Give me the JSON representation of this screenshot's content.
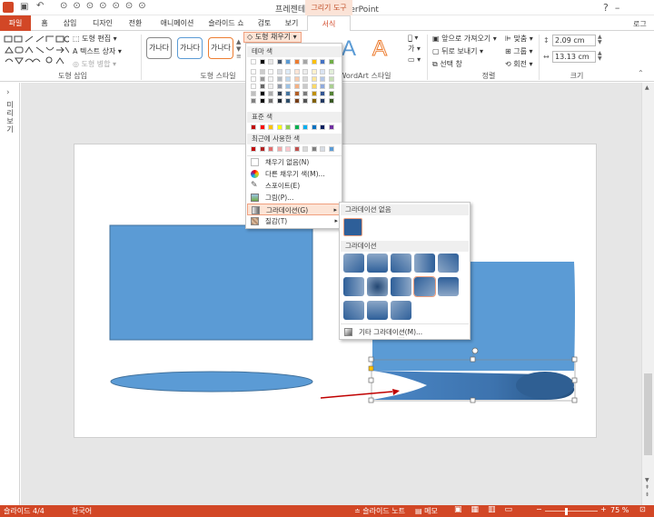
{
  "window": {
    "title": "프레젠테이션2 - PowerPoint",
    "contextual_tab": "그리기 도구",
    "login": "로그"
  },
  "tabs": [
    "파일",
    "홈",
    "삽입",
    "디자인",
    "전환",
    "애니메이션",
    "슬라이드 쇼",
    "검토",
    "보기",
    "서식"
  ],
  "ribbon": {
    "insert_shapes": {
      "edit_shape": "도형 편집",
      "text_box": "텍스트 상자",
      "merge_shapes": "도형 병합",
      "label": "도형 삽입"
    },
    "shape_styles": {
      "style_text": "가나다",
      "fill_button": "도형 채우기",
      "label": "도형 스타일"
    },
    "wordart": {
      "label": "WordArt 스타일",
      "letter": "A"
    },
    "arrange": {
      "bring_forward": "앞으로 가져오기",
      "send_backward": "뒤로 보내기",
      "selection_pane": "선택 창",
      "align": "맞춤",
      "group": "그룹",
      "rotate": "회전",
      "label": "정렬"
    },
    "size": {
      "height": "2.09 cm",
      "width": "13.13 cm",
      "label": "크기"
    }
  },
  "left_pane": {
    "label": "미리보기"
  },
  "fill_menu": {
    "theme_colors_header": "테마 색",
    "standard_colors_header": "표준 색",
    "recent_colors_header": "최근에 사용한 색",
    "items": [
      {
        "label": "채우기 없음(N)",
        "icon": "no-fill-icon"
      },
      {
        "label": "다른 채우기 색(M)...",
        "icon": "color-wheel-icon"
      },
      {
        "label": "스포이트(E)",
        "icon": "eyedropper-icon"
      },
      {
        "label": "그림(P)...",
        "icon": "picture-icon"
      },
      {
        "label": "그라데이션(G)",
        "icon": "gradient-icon"
      },
      {
        "label": "질감(T)",
        "icon": "texture-icon"
      }
    ],
    "theme_colors": [
      "#ffffff",
      "#000000",
      "#e7e6e6",
      "#44546a",
      "#5b9bd5",
      "#ed7d31",
      "#a5a5a5",
      "#ffc000",
      "#4472c4",
      "#70ad47"
    ],
    "standard_colors": [
      "#c00000",
      "#ff0000",
      "#ffc000",
      "#ffff00",
      "#92d050",
      "#00b050",
      "#00b0f0",
      "#0070c0",
      "#002060",
      "#7030a0"
    ],
    "recent_colors": [
      "#c00000",
      "#b22222",
      "#e46c6c",
      "#f4a6a6",
      "#ffc7ce",
      "#c0504d",
      "#d9d9d9",
      "#7f7f7f",
      "#d6dce4",
      "#5b9bd5"
    ]
  },
  "gradient_submenu": {
    "no_gradient_header": "그라데이션 없음",
    "gradient_header": "그라데이션",
    "more_gradients": "기타 그라데이션(M)...",
    "base_color": "#2e5f99"
  },
  "status": {
    "slide": "슬라이드 4/4",
    "language": "한국어",
    "notes": "슬라이드 노트",
    "memo": "메모",
    "zoom": "75 %"
  },
  "colors": {
    "accent": "#d24726",
    "shape_fill": "#5b9bd5",
    "arrow": "#c00000"
  }
}
